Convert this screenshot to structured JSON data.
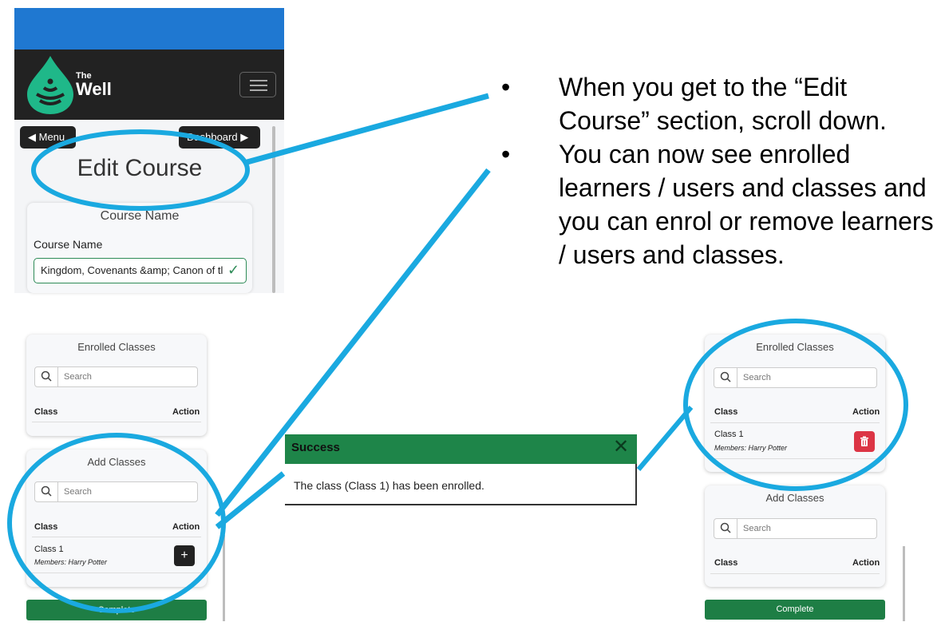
{
  "app": {
    "logo_small": "The",
    "logo_big": "Well",
    "menu_label": "Menu",
    "dashboard_label": "Dashboard",
    "page_title": "Edit Course"
  },
  "course_card": {
    "title": "Course Name",
    "field_label": "Course Name",
    "field_value": "Kingdom, Covenants &amp; Canon of tl"
  },
  "left_enrolled": {
    "title": "Enrolled Classes",
    "search_placeholder": "Search",
    "col_class": "Class",
    "col_action": "Action"
  },
  "left_add": {
    "title": "Add Classes",
    "search_placeholder": "Search",
    "col_class": "Class",
    "col_action": "Action",
    "row_name": "Class 1",
    "row_members": "Members: Harry Potter",
    "row_button": "+"
  },
  "left_complete": "Complete",
  "success": {
    "title": "Success",
    "close": "✕",
    "message": "The class (Class 1) has been enrolled."
  },
  "right_enrolled": {
    "title": "Enrolled Classes",
    "search_placeholder": "Search",
    "col_class": "Class",
    "col_action": "Action",
    "row_name": "Class 1",
    "row_members": "Members: Harry Potter"
  },
  "right_add": {
    "title": "Add Classes",
    "search_placeholder": "Search",
    "col_class": "Class",
    "col_action": "Action"
  },
  "right_complete": "Complete",
  "instructions": [
    "When you get to the “Edit Course” section, scroll down.",
    "You can now see enrolled learners / users and classes and you can enrol or remove learners / users and classes."
  ],
  "colors": {
    "accent_blue": "#1f78d1",
    "navbar": "#222222",
    "success_green": "#1e8549",
    "danger_red": "#dc3545",
    "highlight_cyan": "#1aa9e0"
  }
}
